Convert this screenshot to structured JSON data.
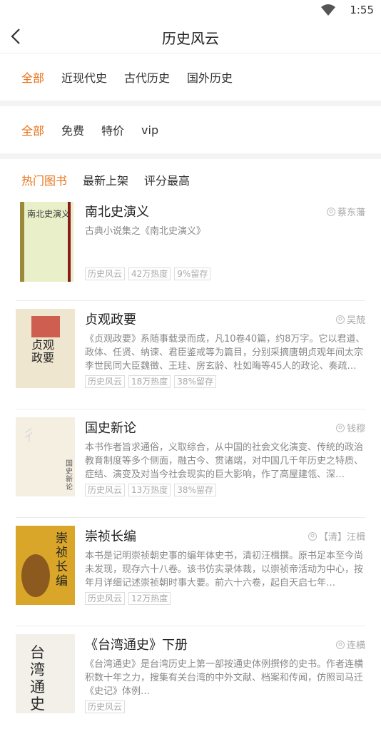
{
  "status": {
    "time": "1:55"
  },
  "header": {
    "title": "历史风云"
  },
  "categories": [
    "全部",
    "近现代史",
    "古代历史",
    "国外历史"
  ],
  "prices": [
    "全部",
    "免费",
    "特价",
    "vip"
  ],
  "sorts": [
    "热门图书",
    "最新上架",
    "评分最高"
  ],
  "books": [
    {
      "title": "南北史演义",
      "author": "蔡东藩",
      "desc": "古典小说集之《南北史演义》",
      "tags": [
        "历史风云",
        "42万热度",
        "9%留存"
      ],
      "cover_text": "南北史演义"
    },
    {
      "title": "贞观政要",
      "author": "吴兢",
      "desc": "《贞观政要》系随事载录而成，凡10卷40篇，约8万字。它以君道、政体、任贤、纳谏、君臣鉴戒等为篇目，分别采摘唐朝贞观年间太宗李世民同大臣魏徵、王珪、房玄龄、杜如晦等45人的政论、奏疏…",
      "tags": [
        "历史风云",
        "18万热度",
        "38%留存"
      ],
      "cover_text": "贞观政要"
    },
    {
      "title": "国史新论",
      "author": "钱穆",
      "desc": "本书作者旨求通俗，义取综合，从中国的社会文化演变、传统的政治教育制度等多个侧面，融古今、贯诸端，对中国几千年历史之特质、症结、演变及对当今社会现实的巨大影响，作了高屋建瓴、深…",
      "tags": [
        "历史风云",
        "13万热度",
        "38%留存"
      ],
      "cover_text": "国史新论"
    },
    {
      "title": "崇祯长编",
      "author": "【清】汪楫",
      "desc": "本书是记明崇祯朝史事的编年体史书，清初汪楫撰。原书足本至今尚未发现，现存六十八卷。该书仿实录体裁，以崇祯帝活动为中心，按年月详细记述崇祯朝时事大要。前六十六卷，起自天启七年…",
      "tags": [
        "历史风云",
        "12万热度"
      ],
      "cover_text": "崇祯长编"
    },
    {
      "title": "《台湾通史》下册",
      "author": "连横",
      "desc": "《台湾通史》是台湾历史上第一部按通史体例撰修的史书。作者连横积数十年之力，搜集有关台湾的中外文献、档案和传闻，仿照司马迁《史记》体例…",
      "tags": [
        "历史风云"
      ],
      "cover_text": "台湾通史"
    }
  ]
}
